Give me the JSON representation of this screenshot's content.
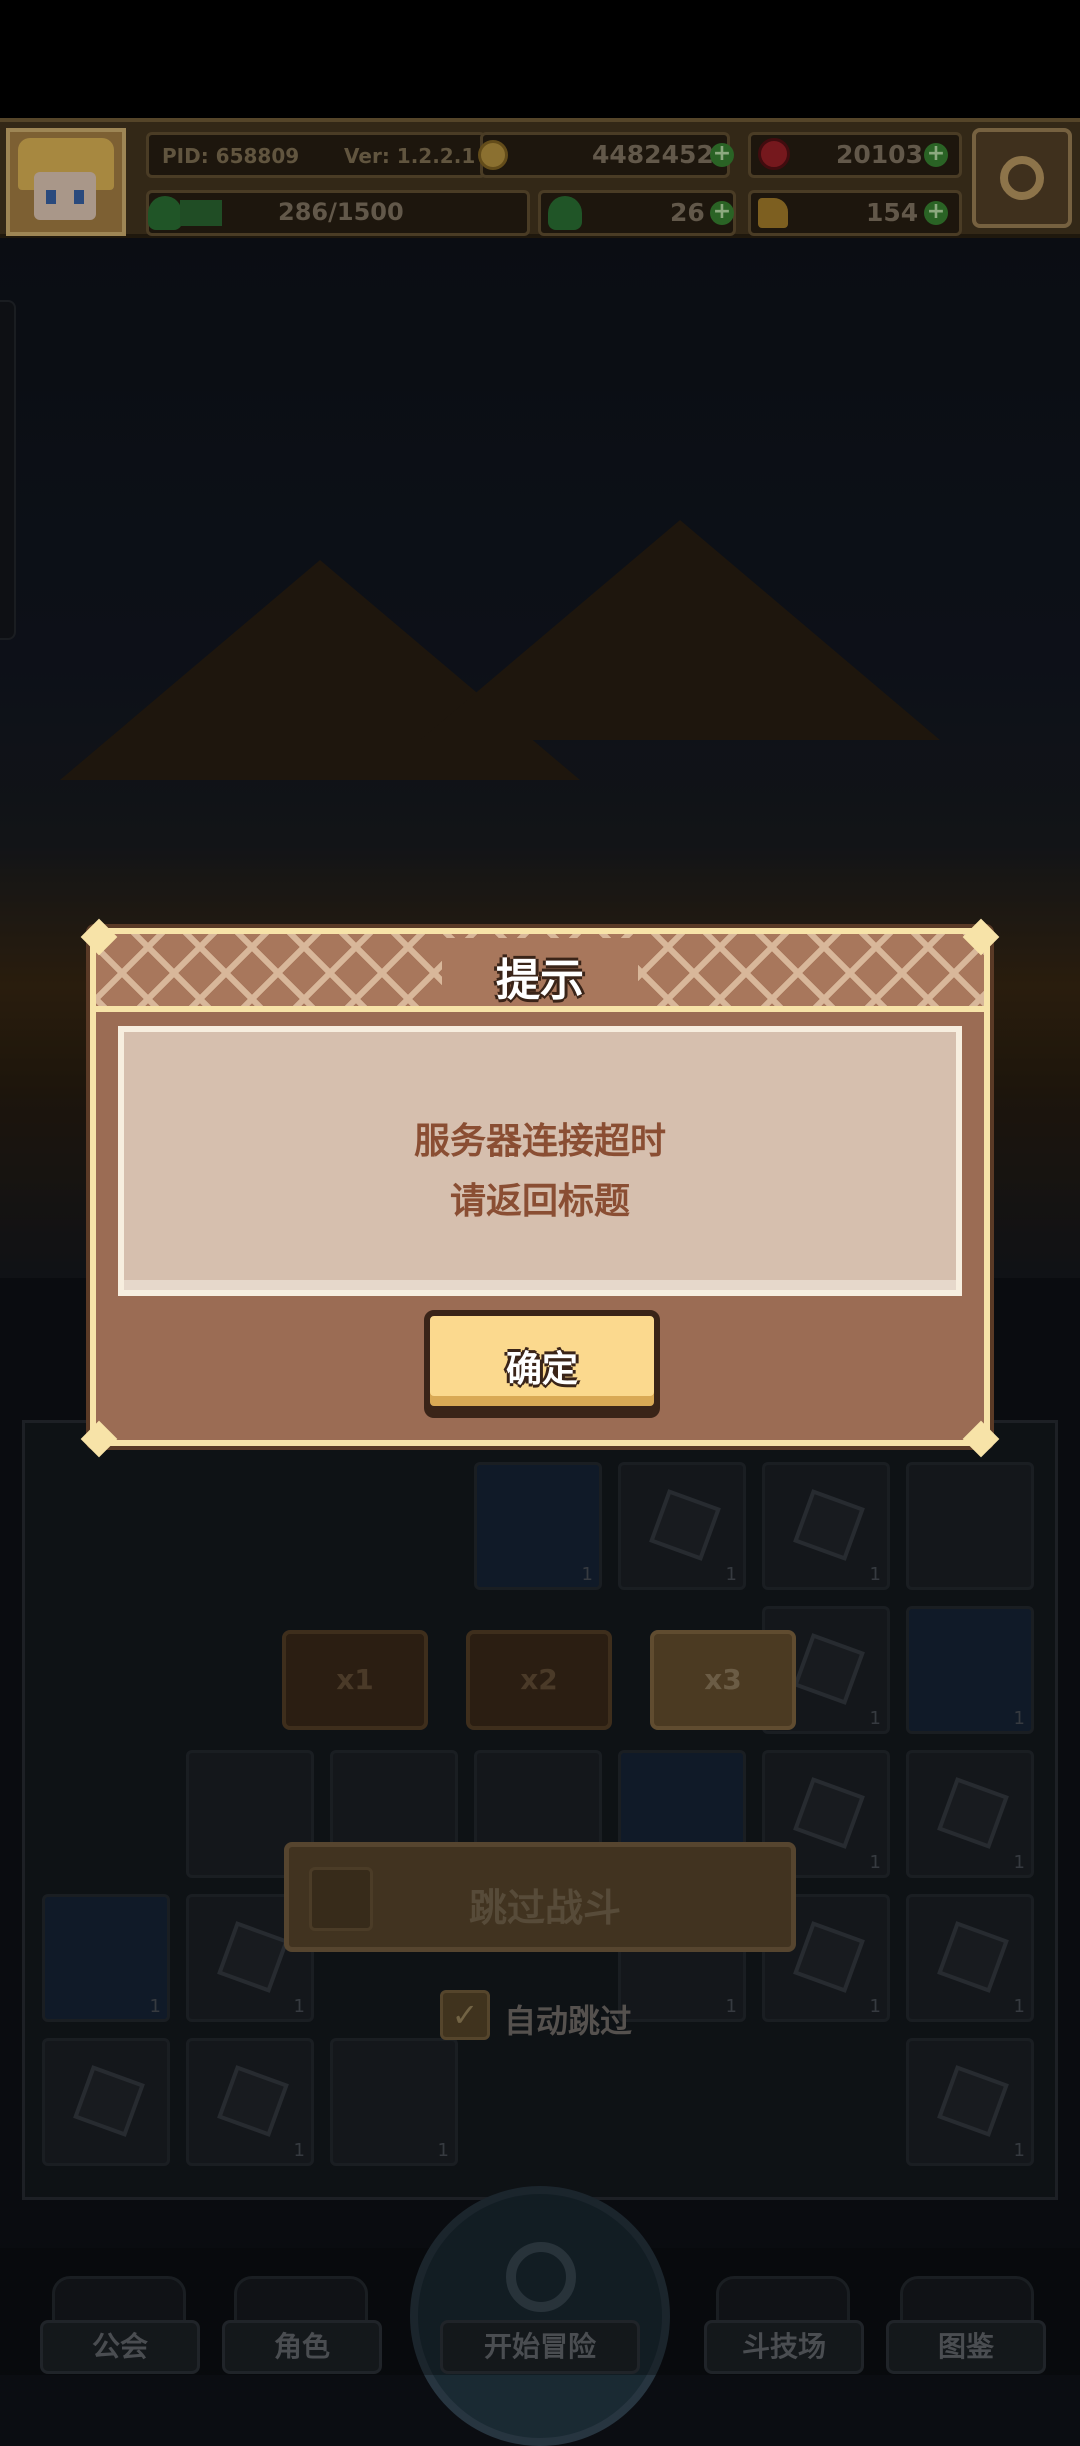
{
  "header": {
    "pid": "PID: 658809",
    "version": "Ver: 1.2.2.1",
    "gold": "4482452",
    "gems": "20103",
    "stamina": "286/1500",
    "clover": "26",
    "flask": "154",
    "stamina_level": 0.06
  },
  "board": {
    "counts": [
      "1",
      "1",
      "1",
      "1",
      "1",
      "1",
      "1",
      "1",
      "1",
      "1",
      "1",
      "1",
      "1",
      "1",
      "1",
      "1",
      "1",
      "1",
      "1"
    ]
  },
  "speed": {
    "x1": "x1",
    "x2": "x2",
    "x3": "x3"
  },
  "skip": {
    "label": "跳过战斗",
    "auto_label": "自动跳过",
    "auto_checked": true
  },
  "nav": {
    "guild": "公会",
    "character": "角色",
    "start": "开始冒险",
    "arena": "斗技场",
    "codex": "图鉴"
  },
  "dialog": {
    "title": "提示",
    "line1": "服务器连接超时",
    "line2": "请返回标题",
    "ok": "确定"
  },
  "icons": {
    "gold": "coin-icon",
    "gem": "red-gem-icon",
    "stamina": "clover-icon",
    "flask": "flask-icon",
    "settings": "gear-icon"
  }
}
